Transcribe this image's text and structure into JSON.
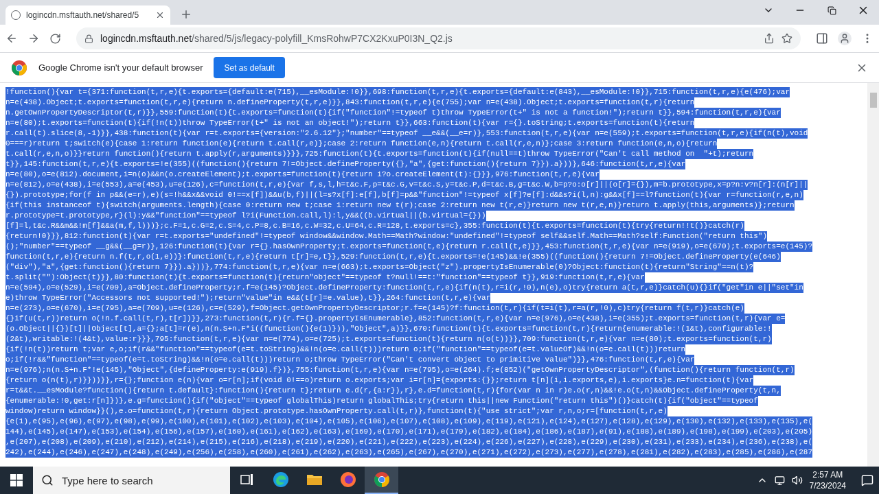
{
  "browser_tab": {
    "title": "logincdn.msftauth.net/shared/5",
    "selected": true
  },
  "address_bar": {
    "host": "logincdn.msftauth.net",
    "path": "/shared/5/js/legacy-polyfill_KmsRohwP7CX2KxuP0I3N_Q2.js"
  },
  "infobar": {
    "message": "Google Chrome isn't your default browser",
    "button": "Set as default"
  },
  "code": {
    "selected": true,
    "lines": [
      "!function(){var t={371:function(t,r,e){t.exports={default:e(715),__esModule:!0}},698:function(t,r,e){t.exports={default:e(843),__esModule:!0}},715:function(t,r,e){e(476);var",
      "n=e(438).Object;t.exports=function(t,r,e){return n.defineProperty(t,r,e)}},843:function(t,r,e){e(755);var n=e(438).Object;t.exports=function(t,r){return",
      "n.getOwnPropertyDescriptor(t,r)}},559:function(t){t.exports=function(t){if(\"function\"!=typeof t)throw TypeError(t+\" is not a function!\");return t}},594:function(t,r,e){var",
      "n=e(80);t.exports=function(t){if(!n(t))throw TypeError(t+\" is not an object!\");return t}},663:function(t){var r={}.toString;t.exports=function(t){return",
      "r.call(t).slice(8,-1)}},438:function(t){var r=t.exports={version:\"2.6.12\"};\"number\"==typeof __e&&(__e=r)},553:function(t,r,e){var n=e(559);t.exports=function(t,r,e){if(n(t),void",
      "0===r)return t;switch(e){case 1:return function(e){return t.call(r,e)};case 2:return function(e,n){return t.call(r,e,n)};case 3:return function(e,n,o){return",
      "t.call(r,e,n,o)}}return function(){return t.apply(r,arguments)}}},725:function(t){t.exports=function(t){if(null==t)throw TypeError(\"Can't call method on  \"+t);return",
      "t}},145:function(t,r,e){t.exports=!e(355)((function(){return 7!=Object.defineProperty({},\"a\",{get:function(){return 7}}).a}))},646:function(t,r,e){var",
      "n=e(80),o=e(812).document,i=n(o)&&n(o.createElement);t.exports=function(t){return i?o.createElement(t):{}}},976:function(t,r,e){var",
      "n=e(812),o=e(438),i=e(553),a=e(453),u=e(126),c=function(t,r,e){var f,s,l,h=t&c.F,p=t&c.G,v=t&c.S,y=t&c.P,d=t&c.B,g=t&c.W,b=p?o:o[r]||(o[r]={}),m=b.prototype,x=p?n:v?n[r]:(n[r]||",
      "{}).prototype;for(f in p&&(e=r),e)(s=!h&&x&&void 0!==x[f])&&u(b,f)||(l=s?x[f]:e[f],b[f]=p&&\"function\"!=typeof x[f]?e[f]:d&&s?i(l,n):g&&x[f]==l?function(t){var r=function(r,e,n)",
      "{if(this instanceof t){switch(arguments.length){case 0:return new t;case 1:return new t(r);case 2:return new t(r,e)}return new t(r,e,n)}return t.apply(this,arguments)};return",
      "r.prototype=t.prototype,r}(l):y&&\"function\"==typeof l?i(Function.call,l):l,y&&((b.virtual||(b.virtual={}))",
      "[f]=l,t&c.R&&m&&!m[f]&&a(m,f,l)))};c.F=1,c.G=2,c.S=4,c.P=8,c.B=16,c.W=32,c.U=64,c.R=128,t.exports=c},355:function(t){t.exports=function(t){try{return!!t()}catch(r)",
      "{return!0}}},812:function(t){var r=t.exports=\"undefined\"!=typeof window&&window.Math==Math?window:\"undefined\"!=typeof self&&self.Math==Math?self:Function(\"return this\")",
      "();\"number\"==typeof __g&&(__g=r)},126:function(t){var r={}.hasOwnProperty;t.exports=function(t,e){return r.call(t,e)}},453:function(t,r,e){var n=e(919),o=e(670);t.exports=e(145)?",
      "function(t,r,e){return n.f(t,r,o(1,e))}:function(t,r,e){return t[r]=e,t}},529:function(t,r,e){t.exports=!e(145)&&!e(355)((function(){return 7!=Object.defineProperty(e(646)",
      "(\"div\"),\"a\",{get:function(){return 7}}).a}))},774:function(t,r,e){var n=e(663);t.exports=Object(\"z\").propertyIsEnumerable(0)?Object:function(t){return\"String\"==n(t)?",
      "t.split(\"\"):Object(t)}},80:function(t){t.exports=function(t){return\"object\"==typeof t?null!==t:\"function\"==typeof t}},919:function(t,r,e){var",
      "n=e(594),o=e(529),i=e(709),a=Object.defineProperty;r.f=e(145)?Object.defineProperty:function(t,r,e){if(n(t),r=i(r,!0),n(e),o)try{return a(t,r,e)}catch(u){}if(\"get\"in e||\"set\"in",
      "e)throw TypeError(\"Accessors not supported!\");return\"value\"in e&&(t[r]=e.value),t}},264:function(t,r,e){var",
      "n=e(273),o=e(670),i=e(795),a=e(709),u=e(126),c=e(529),f=Object.getOwnPropertyDescriptor;r.f=e(145)?f:function(t,r){if(t=i(t),r=a(r,!0),c)try{return f(t,r)}catch(e)",
      "{}if(u(t,r))return o(!n.f.call(t,r),t[r])}},273:function(t,r){r.f={}.propertyIsEnumerable},852:function(t,r,e){var n=e(976),o=e(438),i=e(355);t.exports=function(t,r){var e=",
      "(o.Object||{})[t]||Object[t],a={};a[t]=r(e),n(n.S+n.F*i((function(){e(1)})),\"Object\",a)}},670:function(t){t.exports=function(t,r){return{enumerable:!(1&t),configurable:!",
      "(2&t),writable:!(4&t),value:r}}},795:function(t,r,e){var n=e(774),o=e(725);t.exports=function(t){return n(o(t))}},709:function(t,r,e){var n=e(80);t.exports=function(t,r)",
      "{if(!n(t))return t;var e,o;if(r&&\"function\"==typeof(e=t.toString)&&!n(o=e.call(t)))return o;if(\"function\"==typeof(e=t.valueOf)&&!n(o=e.call(t)))return",
      "o;if(!r&&\"function\"==typeof(e=t.toString)&&!n(o=e.call(t)))return o;throw TypeError(\"Can't convert object to primitive value\")}},476:function(t,r,e){var",
      "n=e(976);n(n.S+n.F*!e(145),\"Object\",{defineProperty:e(919).f})},755:function(t,r,e){var n=e(795),o=e(264).f;e(852)(\"getOwnPropertyDescriptor\",(function(){return function(t,r)",
      "{return o(n(t),r)}}))}},r={};function e(n){var o=r[n];if(void 0!==o)return o.exports;var i=r[n]={exports:{}};return t[n](i,i.exports,e),i.exports}e.n=function(t){var",
      "r=t&&t.__esModule?function(){return t.default}:function(){return t};return e.d(r,{a:r}),r},e.d=function(t,r){for(var n in r)e.o(r,n)&&!e.o(t,n)&&Object.defineProperty(t,n,",
      "{enumerable:!0,get:r[n]})},e.g=function(){if(\"object\"==typeof globalThis)return globalThis;try{return this||new Function(\"return this\")()}catch(t){if(\"object\"==typeof",
      "window)return window}}(),e.o=function(t,r){return Object.prototype.hasOwnProperty.call(t,r)},function(t){\"use strict\";var r,n,o;r=[function(t,r,e)",
      "{e(1),e(95),e(96),e(97),e(98),e(99),e(100),e(101),e(102),e(103),e(104),e(105),e(106),e(107),e(108),e(109),e(119),e(121),e(124),e(127),e(128),e(129),e(130),e(132),e(133),e(135),e(",
      "144),e(145),e(147),e(153),e(154),e(156),e(157),e(160),e(161),e(162),e(163),e(169),e(170),e(171),e(179),e(182),e(184),e(186),e(187),e(91),e(188),e(189),e(198),e(199),e(203),e(205)",
      ",e(207),e(208),e(209),e(210),e(212),e(214),e(215),e(216),e(218),e(219),e(220),e(221),e(222),e(223),e(224),e(226),e(227),e(228),e(229),e(230),e(231),e(233),e(234),e(236),e(238),e(",
      "242),e(244),e(246),e(247),e(248),e(249),e(256),e(258),e(260),e(261),e(262),e(263),e(265),e(267),e(270),e(271),e(272),e(273),e(277),e(278),e(281),e(282),e(283),e(285),e(286),e(287"
    ]
  },
  "taskbar": {
    "search_placeholder": "Type here to search",
    "apps": [
      {
        "kind": "taskview",
        "selected": false
      },
      {
        "kind": "edge",
        "selected": false
      },
      {
        "kind": "explorer",
        "selected": false
      },
      {
        "kind": "firefox",
        "selected": false
      },
      {
        "kind": "chrome",
        "selected": true
      }
    ],
    "time": "2:57 AM",
    "date": "7/23/2024"
  }
}
